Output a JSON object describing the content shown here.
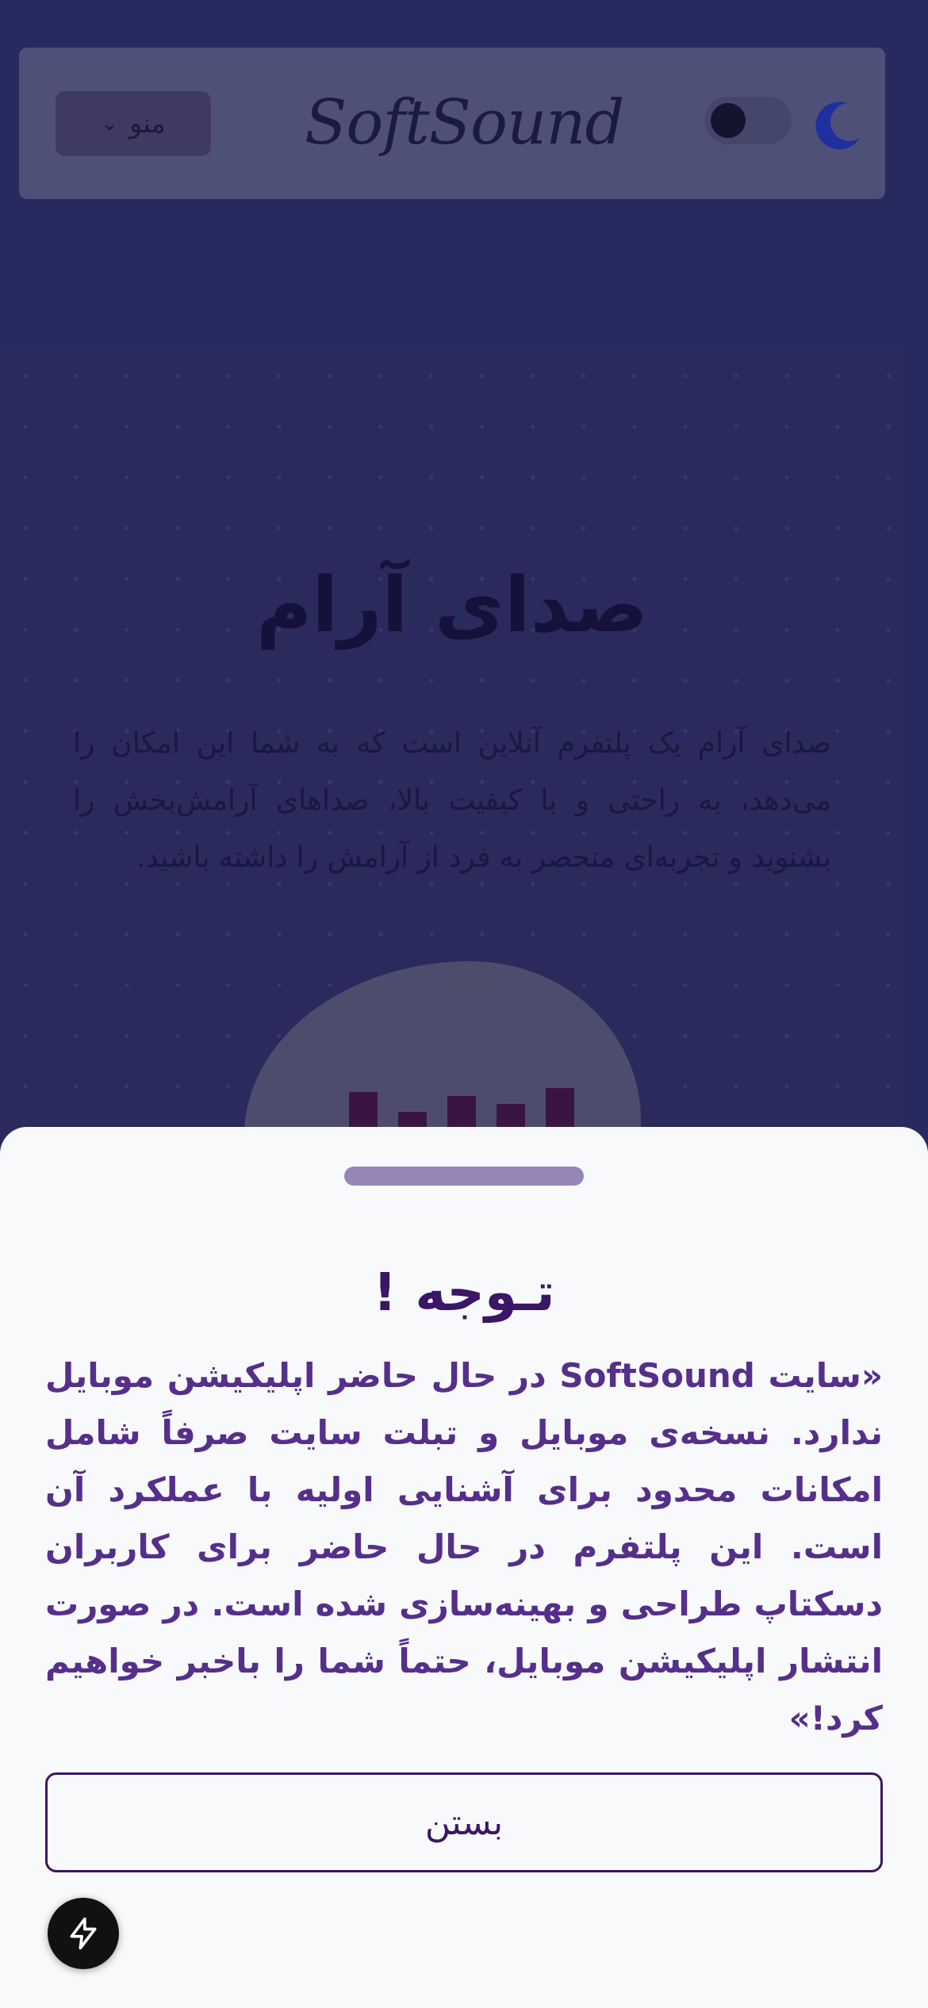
{
  "header": {
    "brand": "SoftSound",
    "menu_label": "منو",
    "theme_toggle_icon": "moon-icon"
  },
  "hero": {
    "title": "صدای آرام",
    "description": "صدای آرام یک پلتفرم آنلاین است که به شما این امکان را می‌دهد، به راحتی و با کیفیت بالا، صداهای آرامش‌بخش را بشنوید و تجربه‌ای منحصر به فرد از آرامش را داشته باشید."
  },
  "notice": {
    "title": "تـوجه !",
    "body": "«سایت SoftSound در حال حاضر اپلیکیشن موبایل ندارد. نسخه‌ی موبایل و تبلت سایت صرفاً شامل امکانات محدود برای آشنایی اولیه با عملکرد آن است. این پلتفرم در حال حاضر برای کاربران دسکتاپ طراحی و بهینه‌سازی شده است. در صورت انتشار اپلیکیشن موبایل، حتماً شما را باخبر خواهیم کرد!»",
    "close_label": "بستن"
  },
  "fab": {
    "icon": "lightning-icon"
  },
  "colors": {
    "accent": "#3a1665",
    "body_text": "#552f8a",
    "handle": "#9686b8",
    "sheet_bg": "#f8f9fb",
    "overlay_bg": "#262a5e"
  }
}
